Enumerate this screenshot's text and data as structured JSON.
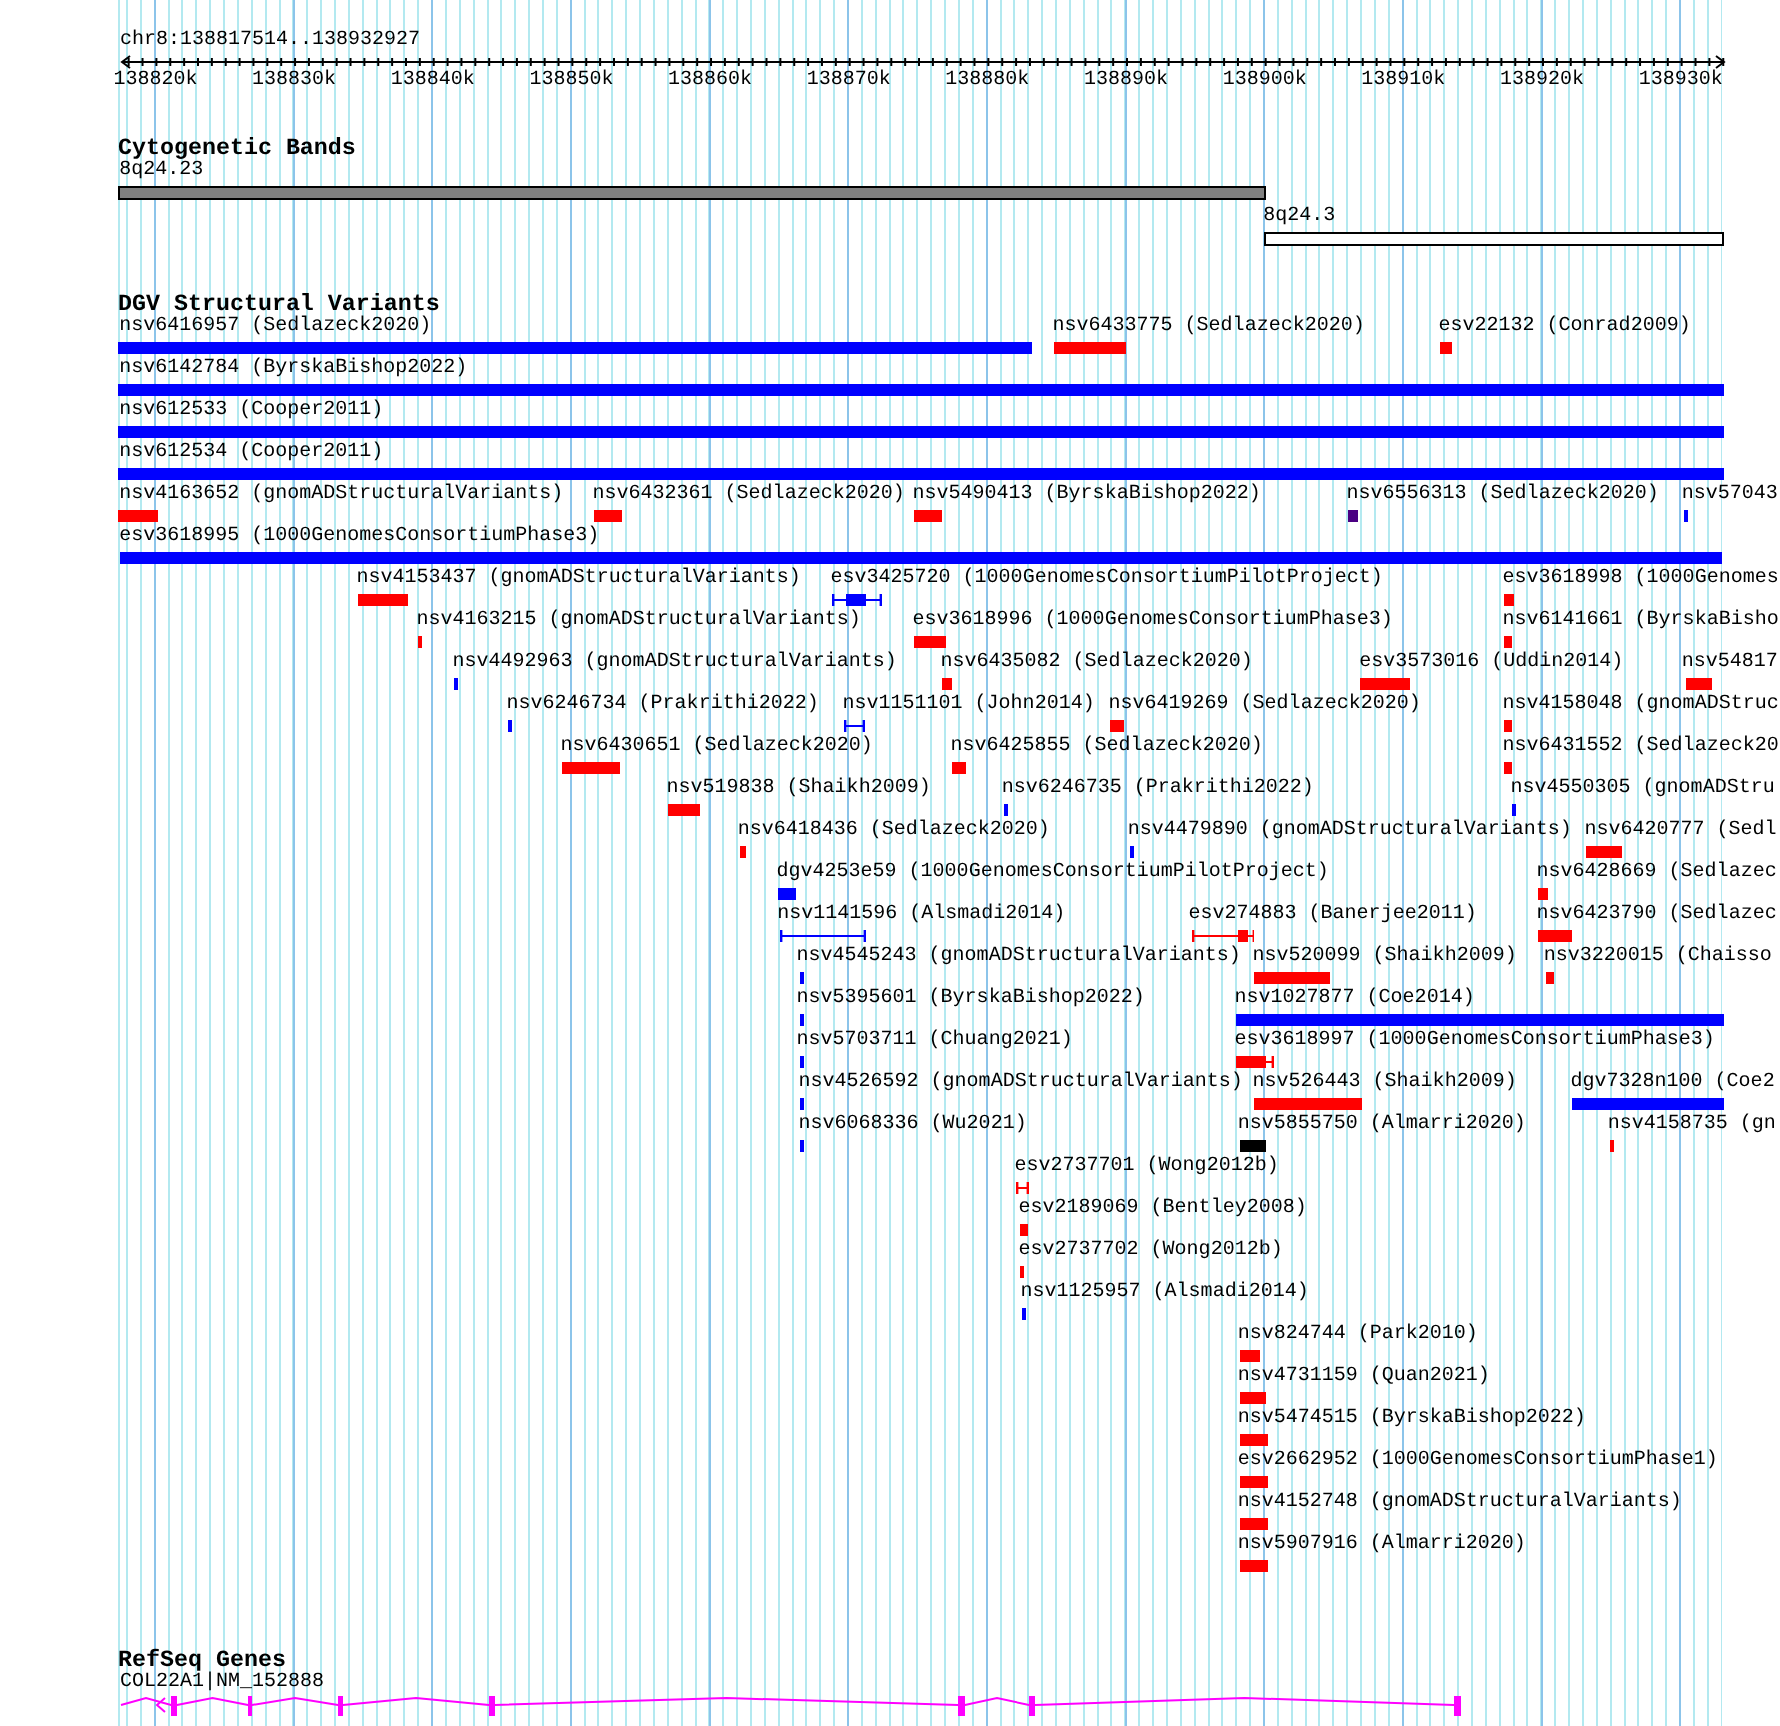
{
  "ruler": {
    "location": "chr8:138817514..138932927",
    "ticks": [
      "138820k",
      "138830k",
      "138840k",
      "138850k",
      "138860k",
      "138870k",
      "138880k",
      "138890k",
      "138900k",
      "138910k",
      "138920k",
      "138930k"
    ]
  },
  "tracks": [
    {
      "kind": "cytoband",
      "title": "Cytogenetic Bands",
      "bands": [
        {
          "label": "8q24.23",
          "color": "#808080"
        },
        {
          "label": "8q24.3",
          "color": "#ffffff"
        }
      ]
    },
    {
      "kind": "variants",
      "title": "DGV Structural Variants",
      "rows": [
        {
          "features": [
            {
              "label": "nsv6416957 (Sedlazeck2020)",
              "kind": "block",
              "color": "#0000ff"
            },
            {
              "label": "nsv6433775 (Sedlazeck2020)",
              "kind": "block",
              "color": "#ff0000"
            },
            {
              "label": "esv22132 (Conrad2009)",
              "kind": "block",
              "color": "#ff0000"
            }
          ]
        },
        {
          "features": [
            {
              "label": "nsv6142784 (ByrskaBishop2022)",
              "kind": "block",
              "color": "#0000ff"
            }
          ]
        },
        {
          "features": [
            {
              "label": "nsv612533 (Cooper2011)",
              "kind": "block",
              "color": "#0000ff"
            }
          ]
        },
        {
          "features": [
            {
              "label": "nsv612534 (Cooper2011)",
              "kind": "block",
              "color": "#0000ff"
            }
          ]
        },
        {
          "features": [
            {
              "label": "nsv4163652 (gnomADStructuralVariants)",
              "kind": "block",
              "color": "#ff0000"
            },
            {
              "label": "nsv6432361 (Sedlazeck2020)",
              "kind": "block",
              "color": "#ff0000"
            },
            {
              "label": "nsv5490413 (ByrskaBishop2022)",
              "kind": "block",
              "color": "#ff0000"
            },
            {
              "label": "nsv6556313 (Sedlazeck2020)",
              "kind": "block",
              "color": "#4b0082"
            },
            {
              "label": "nsv57043",
              "kind": "block",
              "color": "#0000ff"
            }
          ]
        },
        {
          "features": [
            {
              "label": "esv3618995 (1000GenomesConsortiumPhase3)",
              "kind": "block",
              "color": "#0000ff"
            }
          ]
        },
        {
          "features": [
            {
              "label": "nsv4153437 (gnomADStructuralVariants)",
              "kind": "block",
              "color": "#ff0000"
            },
            {
              "label": "esv3425720 (1000GenomesConsortiumPilotProject)",
              "kind": "span",
              "color": "#0000ff"
            },
            {
              "label": "esv3618998 (1000Genomes",
              "kind": "block",
              "color": "#ff0000"
            }
          ]
        },
        {
          "features": [
            {
              "label": "nsv4163215 (gnomADStructuralVariants)",
              "kind": "block",
              "color": "#ff0000"
            },
            {
              "label": "esv3618996 (1000GenomesConsortiumPhase3)",
              "kind": "block",
              "color": "#ff0000"
            },
            {
              "label": "nsv6141661 (ByrskaBisho",
              "kind": "block",
              "color": "#ff0000"
            }
          ]
        },
        {
          "features": [
            {
              "label": "nsv4492963 (gnomADStructuralVariants)",
              "kind": "block",
              "color": "#0000ff"
            },
            {
              "label": "nsv6435082 (Sedlazeck2020)",
              "kind": "block",
              "color": "#ff0000"
            },
            {
              "label": "esv3573016 (Uddin2014)",
              "kind": "block",
              "color": "#ff0000"
            },
            {
              "label": "nsv54817",
              "kind": "block",
              "color": "#ff0000"
            }
          ]
        },
        {
          "features": [
            {
              "label": "nsv6246734 (Prakrithi2022)",
              "kind": "block",
              "color": "#0000ff"
            },
            {
              "label": "nsv1151101 (John2014)",
              "kind": "span",
              "color": "#0000ff"
            },
            {
              "label": "nsv6419269 (Sedlazeck2020)",
              "kind": "block",
              "color": "#ff0000"
            },
            {
              "label": "nsv4158048 (gnomADStruc",
              "kind": "block",
              "color": "#ff0000"
            }
          ]
        },
        {
          "features": [
            {
              "label": "nsv6430651 (Sedlazeck2020)",
              "kind": "block",
              "color": "#ff0000"
            },
            {
              "label": "nsv6425855 (Sedlazeck2020)",
              "kind": "block",
              "color": "#ff0000"
            },
            {
              "label": "nsv6431552 (Sedlazeck20",
              "kind": "block",
              "color": "#ff0000"
            }
          ]
        },
        {
          "features": [
            {
              "label": "nsv519838 (Shaikh2009)",
              "kind": "block",
              "color": "#ff0000"
            },
            {
              "label": "nsv6246735 (Prakrithi2022)",
              "kind": "block",
              "color": "#0000ff"
            },
            {
              "label": "nsv4550305 (gnomADStru",
              "kind": "block",
              "color": "#0000ff"
            }
          ]
        },
        {
          "features": [
            {
              "label": "nsv6418436 (Sedlazeck2020)",
              "kind": "block",
              "color": "#ff0000"
            },
            {
              "label": "nsv4479890 (gnomADStructuralVariants)",
              "kind": "block",
              "color": "#0000ff"
            },
            {
              "label": "nsv6420777 (Sedl",
              "kind": "block",
              "color": "#ff0000"
            }
          ]
        },
        {
          "features": [
            {
              "label": "dgv4253e59 (1000GenomesConsortiumPilotProject)",
              "kind": "block",
              "color": "#0000ff"
            },
            {
              "label": "nsv6428669 (Sedlazec",
              "kind": "block",
              "color": "#ff0000"
            }
          ]
        },
        {
          "features": [
            {
              "label": "nsv1141596 (Alsmadi2014)",
              "kind": "span",
              "color": "#0000ff"
            },
            {
              "label": "esv274883 (Banerjee2011)",
              "kind": "span",
              "color": "#ff0000"
            },
            {
              "label": "nsv6423790 (Sedlazec",
              "kind": "block",
              "color": "#ff0000"
            }
          ]
        },
        {
          "features": [
            {
              "label": "nsv4545243 (gnomADStructuralVariants)",
              "kind": "block",
              "color": "#0000ff"
            },
            {
              "label": "nsv520099 (Shaikh2009)",
              "kind": "block",
              "color": "#ff0000"
            },
            {
              "label": "nsv3220015 (Chaisso",
              "kind": "block",
              "color": "#ff0000"
            }
          ]
        },
        {
          "features": [
            {
              "label": "nsv5395601 (ByrskaBishop2022)",
              "kind": "block",
              "color": "#0000ff"
            },
            {
              "label": "nsv1027877 (Coe2014)",
              "kind": "block",
              "color": "#0000ff"
            }
          ]
        },
        {
          "features": [
            {
              "label": "nsv5703711 (Chuang2021)",
              "kind": "block",
              "color": "#0000ff"
            },
            {
              "label": "esv3618997 (1000GenomesConsortiumPhase3)",
              "kind": "span",
              "color": "#ff0000"
            }
          ]
        },
        {
          "features": [
            {
              "label": "nsv4526592 (gnomADStructuralVariants)",
              "kind": "block",
              "color": "#0000ff"
            },
            {
              "label": "nsv526443 (Shaikh2009)",
              "kind": "block",
              "color": "#ff0000"
            },
            {
              "label": "dgv7328n100 (Coe2",
              "kind": "block",
              "color": "#0000ff"
            }
          ]
        },
        {
          "features": [
            {
              "label": "nsv6068336 (Wu2021)",
              "kind": "block",
              "color": "#0000ff"
            },
            {
              "label": "nsv5855750 (Almarri2020)",
              "kind": "block",
              "color": "#000000"
            },
            {
              "label": "nsv4158735 (gn",
              "kind": "block",
              "color": "#ff0000"
            }
          ]
        },
        {
          "features": [
            {
              "label": "esv2737701 (Wong2012b)",
              "kind": "span",
              "color": "#ff0000"
            }
          ]
        },
        {
          "features": [
            {
              "label": "esv2189069 (Bentley2008)",
              "kind": "block",
              "color": "#ff0000"
            }
          ]
        },
        {
          "features": [
            {
              "label": "esv2737702 (Wong2012b)",
              "kind": "block",
              "color": "#ff0000"
            }
          ]
        },
        {
          "features": [
            {
              "label": "nsv1125957 (Alsmadi2014)",
              "kind": "block",
              "color": "#0000ff"
            }
          ]
        },
        {
          "features": [
            {
              "label": "nsv824744 (Park2010)",
              "kind": "block",
              "color": "#ff0000"
            }
          ]
        },
        {
          "features": [
            {
              "label": "nsv4731159 (Quan2021)",
              "kind": "block",
              "color": "#ff0000"
            }
          ]
        },
        {
          "features": [
            {
              "label": "nsv5474515 (ByrskaBishop2022)",
              "kind": "block",
              "color": "#ff0000"
            }
          ]
        },
        {
          "features": [
            {
              "label": "esv2662952 (1000GenomesConsortiumPhase1)",
              "kind": "block",
              "color": "#ff0000"
            }
          ]
        },
        {
          "features": [
            {
              "label": "nsv4152748 (gnomADStructuralVariants)",
              "kind": "block",
              "color": "#ff0000"
            }
          ]
        },
        {
          "features": [
            {
              "label": "nsv5907916 (Almarri2020)",
              "kind": "block",
              "color": "#ff0000"
            }
          ]
        }
      ]
    },
    {
      "kind": "genes",
      "title": "RefSeq Genes",
      "genes": [
        {
          "label": "COL22A1|NM_152888",
          "reverse_strand": true
        }
      ]
    }
  ]
}
